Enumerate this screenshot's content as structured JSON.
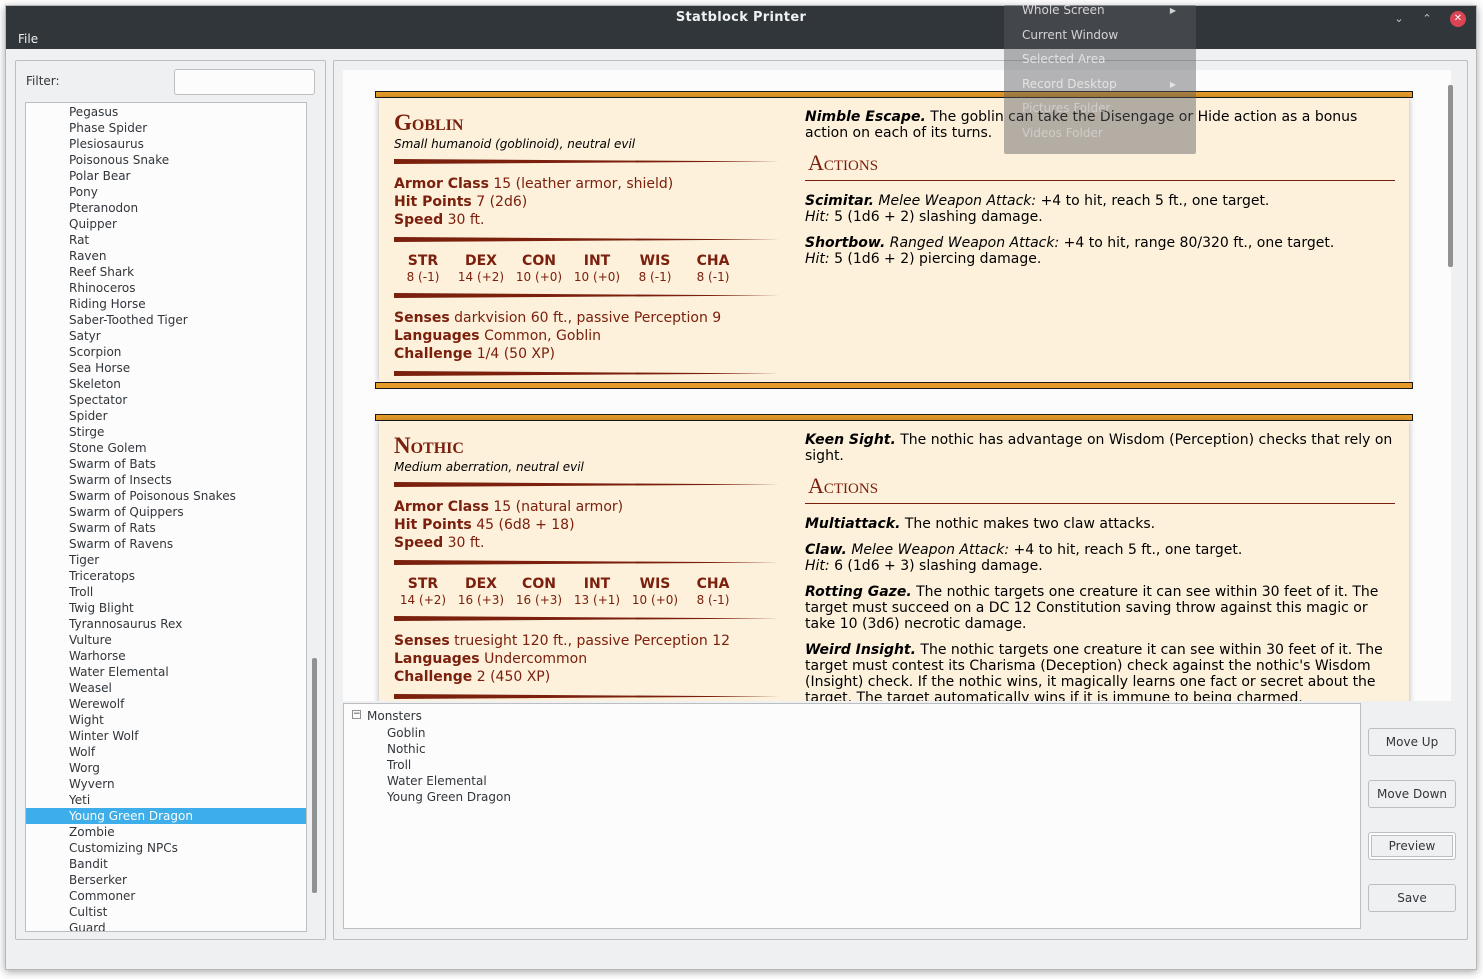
{
  "window": {
    "title": "Statblock Printer",
    "controls": {
      "minimize": "⌄",
      "maximize": "⌃",
      "close": "✕"
    }
  },
  "menubar": {
    "file": "File"
  },
  "filter": {
    "label": "Filter:",
    "value": ""
  },
  "monster_list": {
    "items": [
      "Pegasus",
      "Phase Spider",
      "Plesiosaurus",
      "Poisonous Snake",
      "Polar Bear",
      "Pony",
      "Pteranodon",
      "Quipper",
      "Rat",
      "Raven",
      "Reef Shark",
      "Rhinoceros",
      "Riding Horse",
      "Saber-Toothed Tiger",
      "Satyr",
      "Scorpion",
      "Sea Horse",
      "Skeleton",
      "Spectator",
      "Spider",
      "Stirge",
      "Stone Golem",
      "Swarm of Bats",
      "Swarm of Insects",
      "Swarm of Poisonous Snakes",
      "Swarm of Quippers",
      "Swarm of Rats",
      "Swarm of Ravens",
      "Tiger",
      "Triceratops",
      "Troll",
      "Twig Blight",
      "Tyrannosaurus Rex",
      "Vulture",
      "Warhorse",
      "Water Elemental",
      "Weasel",
      "Werewolf",
      "Wight",
      "Winter Wolf",
      "Wolf",
      "Worg",
      "Wyvern",
      "Yeti",
      "Young Green Dragon",
      "Zombie",
      "Customizing NPCs",
      "Bandit",
      "Berserker",
      "Commoner",
      "Cultist",
      "Guard"
    ],
    "selected": "Young Green Dragon"
  },
  "goblin": {
    "name": "Goblin",
    "type": "Small humanoid (goblinoid), neutral evil",
    "armor_class_label": "Armor Class",
    "armor_class": "15 (leather armor, shield)",
    "hit_points_label": "Hit Points",
    "hit_points": "7 (2d6)",
    "speed_label": "Speed",
    "speed": "30 ft.",
    "abilities": [
      {
        "name": "STR",
        "value": "8 (-1)"
      },
      {
        "name": "DEX",
        "value": "14 (+2)"
      },
      {
        "name": "CON",
        "value": "10 (+0)"
      },
      {
        "name": "INT",
        "value": "10 (+0)"
      },
      {
        "name": "WIS",
        "value": "8 (-1)"
      },
      {
        "name": "CHA",
        "value": "8 (-1)"
      }
    ],
    "senses_label": "Senses",
    "senses": "darkvision 60 ft., passive Perception 9",
    "languages_label": "Languages",
    "languages": "Common, Goblin",
    "challenge_label": "Challenge",
    "challenge": "1/4 (50 XP)",
    "trait_name": "Nimble Escape.",
    "trait_text": "The goblin can take the Disengage or Hide action as a bonus action on each of its turns.",
    "actions_heading": "Actions",
    "actions": [
      {
        "name": "Scimitar.",
        "type": "Melee Weapon Attack:",
        "text": "+4 to hit, reach 5 ft., one target.",
        "hit_label": "Hit:",
        "hit": "5 (1d6 + 2) slashing damage."
      },
      {
        "name": "Shortbow.",
        "type": "Ranged Weapon Attack:",
        "text": "+4 to hit, range 80/320 ft., one target.",
        "hit_label": "Hit:",
        "hit": "5 (1d6 + 2) piercing damage."
      }
    ]
  },
  "nothic": {
    "name": "Nothic",
    "type": "Medium aberration, neutral evil",
    "armor_class_label": "Armor Class",
    "armor_class": "15 (natural armor)",
    "hit_points_label": "Hit Points",
    "hit_points": "45 (6d8 + 18)",
    "speed_label": "Speed",
    "speed": "30 ft.",
    "abilities": [
      {
        "name": "STR",
        "value": "14 (+2)"
      },
      {
        "name": "DEX",
        "value": "16 (+3)"
      },
      {
        "name": "CON",
        "value": "16 (+3)"
      },
      {
        "name": "INT",
        "value": "13 (+1)"
      },
      {
        "name": "WIS",
        "value": "10 (+0)"
      },
      {
        "name": "CHA",
        "value": "8 (-1)"
      }
    ],
    "senses_label": "Senses",
    "senses": "truesight 120 ft., passive Perception 12",
    "languages_label": "Languages",
    "languages": "Undercommon",
    "challenge_label": "Challenge",
    "challenge": "2 (450 XP)",
    "trait_name": "Keen Sight.",
    "trait_text": "The nothic has advantage on Wisdom (Perception) checks that rely on sight.",
    "actions_heading": "Actions",
    "multiattack_name": "Multiattack.",
    "multiattack_text": "The nothic makes two claw attacks.",
    "claw_name": "Claw.",
    "claw_type": "Melee Weapon Attack:",
    "claw_text": "+4 to hit, reach 5 ft., one target.",
    "claw_hit_label": "Hit:",
    "claw_hit": "6 (1d6 + 3) slashing damage.",
    "rotting_name": "Rotting Gaze.",
    "rotting_text": "The nothic targets one creature it can see within 30 feet of it. The target must succeed on a DC 12 Constitution saving throw against this magic or take 10 (3d6) necrotic damage.",
    "weird_name": "Weird Insight.",
    "weird_text": "The nothic targets one creature it can see within 30 feet of it. The target must contest its Charisma (Deception) check against the nothic's Wisdom (Insight) check. If the nothic wins, it magically learns one fact or secret about the target. The target automatically wins if it is immune to being charmed."
  },
  "tree": {
    "root": "Monsters",
    "toggle": "−",
    "items": [
      "Goblin",
      "Nothic",
      "Troll",
      "Water Elemental",
      "Young Green Dragon"
    ]
  },
  "buttons": {
    "move_up": "Move Up",
    "move_down": "Move Down",
    "preview": "Preview",
    "save": "Save"
  },
  "screenshot_menu": {
    "items": [
      "Whole Screen",
      "Current Window",
      "Selected Area",
      "Record Desktop",
      "Pictures Folder",
      "Videos Folder"
    ],
    "submenu_arrow": "▶"
  },
  "colors": {
    "title_bar": "#31363b",
    "selection": "#3daee9",
    "statblock_bg": "#fdf1dc",
    "statblock_accent": "#7a200d",
    "statblock_bar": "#e69a28"
  }
}
